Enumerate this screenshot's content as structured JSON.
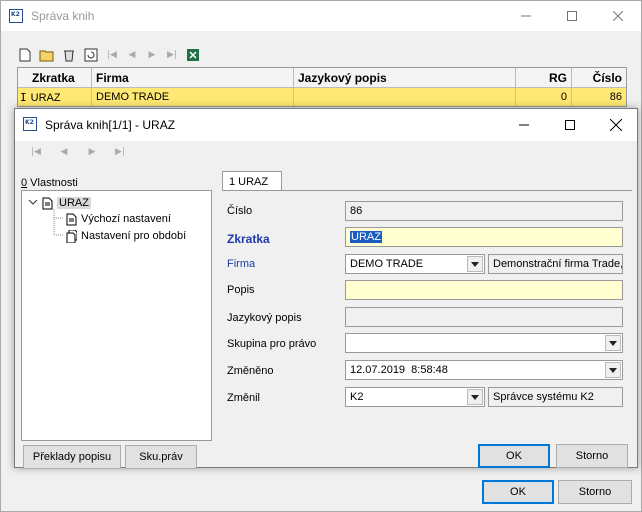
{
  "back_window": {
    "title": "Správa knih",
    "grid": {
      "columns": [
        "Zkratka",
        "Firma",
        "Jazykový popis",
        "RG",
        "Číslo"
      ],
      "row": {
        "marker": "I",
        "zkratka": "URAZ",
        "firma": "DEMO TRADE",
        "jazykovy_popis": "",
        "rg": "0",
        "cislo": "86"
      }
    },
    "ok_label": "OK",
    "storno_label": "Storno"
  },
  "dialog": {
    "title": "Správa knih[1/1] - URAZ",
    "tree_label_underline": "0",
    "tree_label_rest": " Vlastnosti",
    "tree": {
      "root": "URAZ",
      "children": [
        "Výchozí nastavení",
        "Nastavení pro období"
      ]
    },
    "tab_label": "1 URAZ",
    "fields": {
      "cislo": {
        "label": "Číslo",
        "value": "86"
      },
      "zkratka": {
        "label": "Zkratka",
        "value": "URAZ"
      },
      "firma": {
        "label": "Firma",
        "value": "DEMO TRADE",
        "description": "Demonstrační firma Trade,"
      },
      "popis": {
        "label": "Popis",
        "value": ""
      },
      "jazykovy_popis": {
        "label": "Jazykový popis",
        "value": ""
      },
      "skupina": {
        "label": "Skupina pro právo",
        "value": ""
      },
      "zmeneno": {
        "label": "Změněno",
        "value": "12.07.2019  8:58:48"
      },
      "zmenil": {
        "label": "Změnil",
        "value": "K2",
        "description": "Správce systému K2"
      }
    },
    "buttons": {
      "preklady": "Překlady popisu",
      "sku_prav": "Sku.práv",
      "ok": "OK",
      "storno": "Storno"
    }
  }
}
